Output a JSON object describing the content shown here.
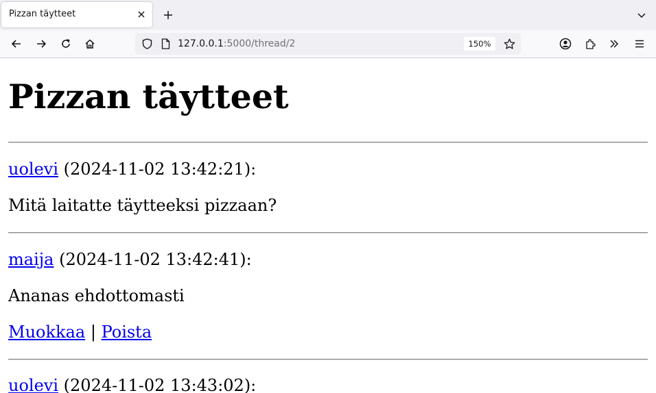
{
  "browser": {
    "tab": {
      "title": "Pizzan täytteet"
    },
    "url": {
      "host": "127.0.0.1",
      "rest": ":5000/thread/2"
    },
    "zoom": "150%"
  },
  "page": {
    "title": "Pizzan täytteet",
    "messages": [
      {
        "user": "uolevi",
        "timestamp": " (2024-11-02 13:42:21):",
        "content": "Mitä laitatte täytteeksi pizzaan?"
      },
      {
        "user": "maija",
        "timestamp": " (2024-11-02 13:42:41):",
        "content": "Ananas ehdottomasti",
        "edit_label": "Muokkaa",
        "separator": "|",
        "delete_label": "Poista"
      },
      {
        "user": "uolevi",
        "timestamp": " (2024-11-02 13:43:02):"
      }
    ]
  },
  "colors": {
    "link": "#0000ee",
    "chrome_bg": "#f0f0f4",
    "toolbar_bg": "#f9f9fb"
  },
  "icons": [
    "close-icon",
    "plus-icon",
    "chevron-down-icon",
    "back-arrow-icon",
    "forward-arrow-icon",
    "reload-icon",
    "home-icon",
    "shield-icon",
    "page-icon",
    "star-icon",
    "account-icon",
    "extensions-icon",
    "overflow-icon",
    "menu-icon"
  ]
}
